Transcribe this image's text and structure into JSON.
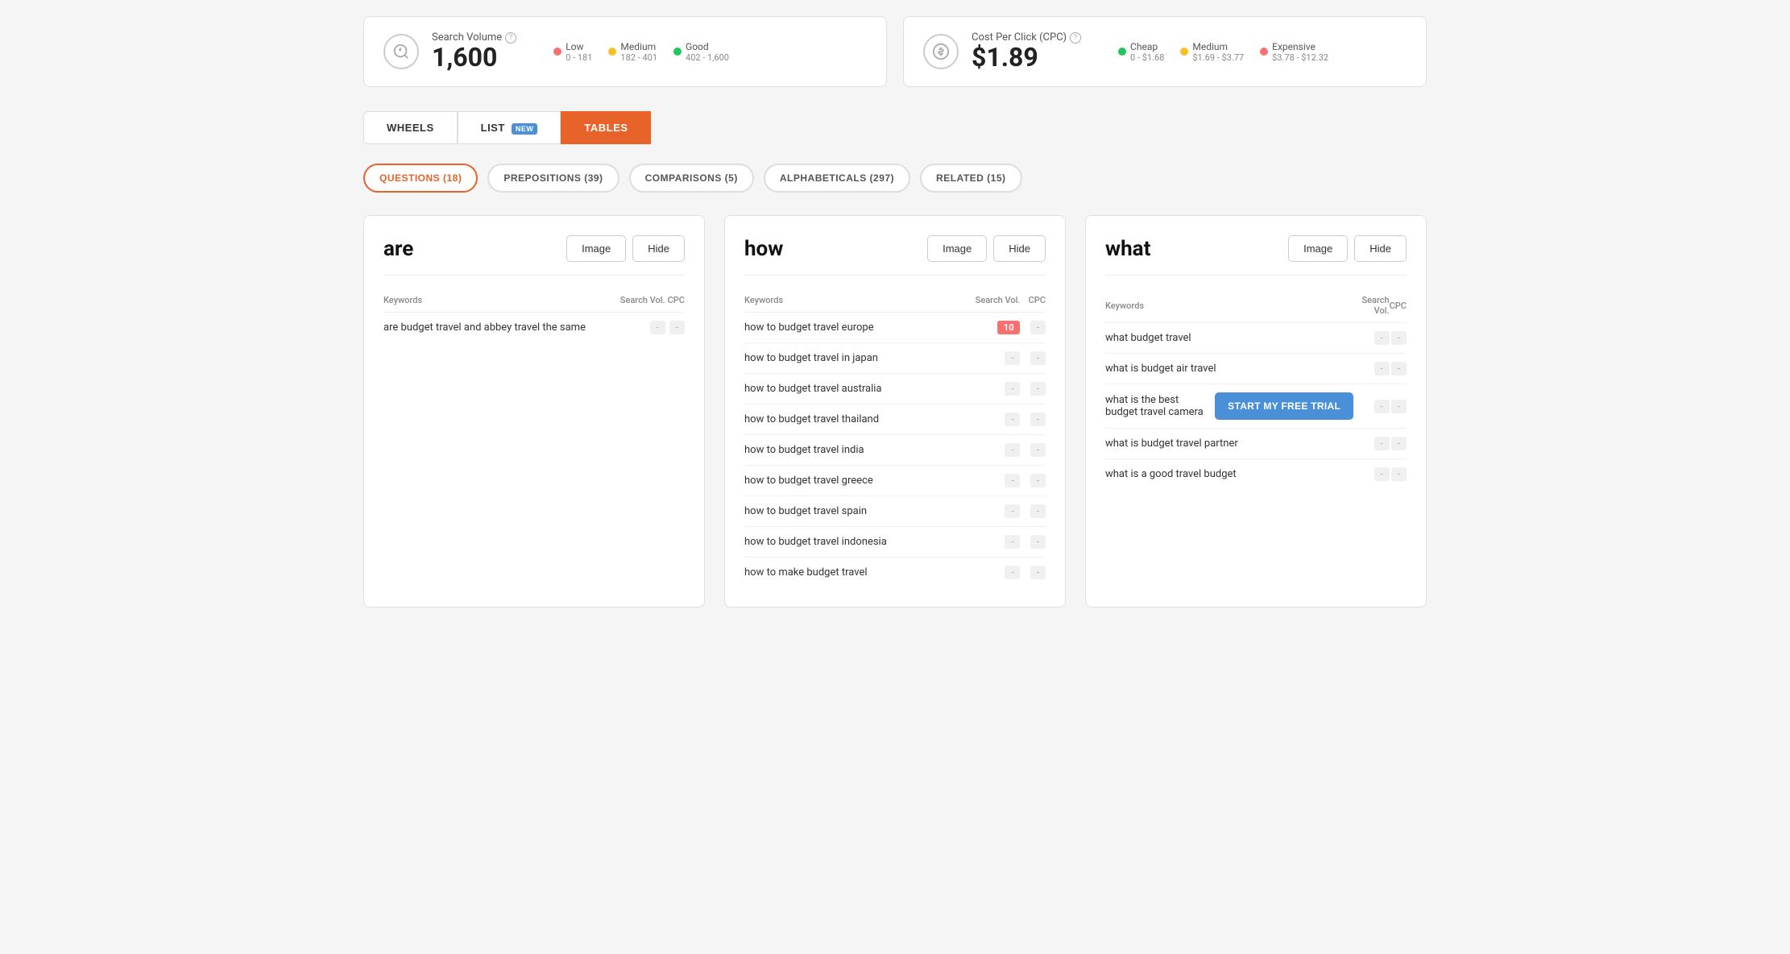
{
  "stats": {
    "search_volume": {
      "label": "Search Volume",
      "value": "1,600",
      "help": "?",
      "legend": [
        {
          "name": "Low",
          "range": "0 - 181",
          "color": "#f87171"
        },
        {
          "name": "Medium",
          "range": "182 - 401",
          "color": "#fbbf24"
        },
        {
          "name": "Good",
          "range": "402 - 1,600",
          "color": "#22c55e"
        }
      ]
    },
    "cpc": {
      "label": "Cost Per Click (CPC)",
      "value": "$1.89",
      "help": "?",
      "legend": [
        {
          "name": "Cheap",
          "range": "0 - $1.68",
          "color": "#22c55e"
        },
        {
          "name": "Medium",
          "range": "$1.69 - $3.77",
          "color": "#fbbf24"
        },
        {
          "name": "Expensive",
          "range": "$3.78 - $12.32",
          "color": "#f87171"
        }
      ]
    }
  },
  "tabs": [
    {
      "label": "WHEELS",
      "active": false,
      "badge": null
    },
    {
      "label": "LIST",
      "active": false,
      "badge": "NEW"
    },
    {
      "label": "TABLES",
      "active": true,
      "badge": null
    }
  ],
  "filters": [
    {
      "label": "QUESTIONS (18)",
      "active": true
    },
    {
      "label": "PREPOSITIONS (39)",
      "active": false
    },
    {
      "label": "COMPARISONS (5)",
      "active": false
    },
    {
      "label": "ALPHABETICALS (297)",
      "active": false
    },
    {
      "label": "RELATED (15)",
      "active": false
    }
  ],
  "cards": [
    {
      "title": "are",
      "image_label": "Image",
      "hide_label": "Hide",
      "columns": [
        "Keywords",
        "Search Vol.",
        "CPC"
      ],
      "rows": [
        {
          "keyword": "are budget travel and abbey travel the same",
          "vol": "-",
          "cpc": "-",
          "vol_highlight": false
        }
      ]
    },
    {
      "title": "how",
      "image_label": "Image",
      "hide_label": "Hide",
      "columns": [
        "Keywords",
        "Search Vol.",
        "CPC"
      ],
      "rows": [
        {
          "keyword": "how to budget travel europe",
          "vol": "10",
          "cpc": "-",
          "vol_highlight": true
        },
        {
          "keyword": "how to budget travel in japan",
          "vol": "-",
          "cpc": "-",
          "vol_highlight": false
        },
        {
          "keyword": "how to budget travel australia",
          "vol": "-",
          "cpc": "-",
          "vol_highlight": false
        },
        {
          "keyword": "how to budget travel thailand",
          "vol": "-",
          "cpc": "-",
          "vol_highlight": false
        },
        {
          "keyword": "how to budget travel india",
          "vol": "-",
          "cpc": "-",
          "vol_highlight": false
        },
        {
          "keyword": "how to budget travel greece",
          "vol": "-",
          "cpc": "-",
          "vol_highlight": false
        },
        {
          "keyword": "how to budget travel spain",
          "vol": "-",
          "cpc": "-",
          "vol_highlight": false
        },
        {
          "keyword": "how to budget travel indonesia",
          "vol": "-",
          "cpc": "-",
          "vol_highlight": false
        },
        {
          "keyword": "how to make budget travel",
          "vol": "-",
          "cpc": "-",
          "vol_highlight": false
        }
      ]
    },
    {
      "title": "what",
      "image_label": "Image",
      "hide_label": "Hide",
      "columns": [
        "Keywords",
        "Search Vol.",
        "CPC"
      ],
      "rows": [
        {
          "keyword": "what budget travel",
          "vol": "-",
          "cpc": "-",
          "vol_highlight": false
        },
        {
          "keyword": "what is budget air travel",
          "vol": "-",
          "cpc": "-",
          "vol_highlight": false
        },
        {
          "keyword": "what is the best budget travel camera",
          "vol": "-",
          "cpc": "-",
          "vol_highlight": false,
          "show_trial": true
        },
        {
          "keyword": "what is budget travel partner",
          "vol": "-",
          "cpc": "-",
          "vol_highlight": false
        },
        {
          "keyword": "what is a good travel budget",
          "vol": "-",
          "cpc": "-",
          "vol_highlight": false
        }
      ]
    }
  ],
  "trial_button": "START MY FREE TRIAL"
}
